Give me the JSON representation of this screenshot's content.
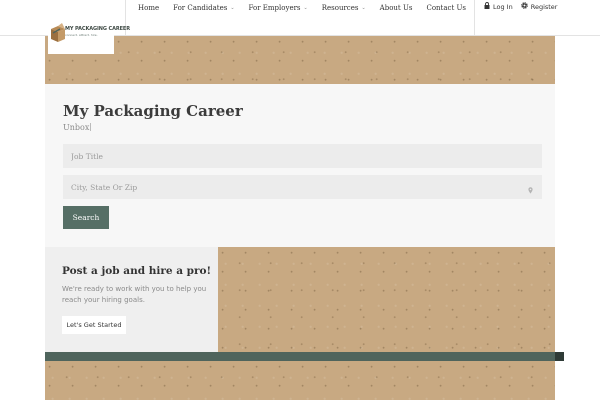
{
  "brand": {
    "name": "MY PACKAGING CAREER",
    "tagline": "connect. attract. hire.",
    "colors": {
      "accent": "#566f66",
      "stripe": "#4f645c",
      "cardboard": "#c8a982"
    }
  },
  "nav": {
    "items": [
      {
        "label": "Home",
        "dropdown": false
      },
      {
        "label": "For Candidates",
        "dropdown": true
      },
      {
        "label": "For Employers",
        "dropdown": true
      },
      {
        "label": "Resources",
        "dropdown": true
      },
      {
        "label": "About Us",
        "dropdown": false
      },
      {
        "label": "Contact Us",
        "dropdown": false
      }
    ],
    "chevron": "⌄"
  },
  "auth": {
    "login": {
      "label": "Log In",
      "icon": "lock-icon"
    },
    "register": {
      "label": "Register",
      "icon": "gear-icon"
    }
  },
  "search": {
    "title": "My Packaging Career",
    "subtitle": "Unbox",
    "job_placeholder": "Job Title",
    "location_placeholder": "City, State Or Zip",
    "button_label": "Search"
  },
  "hire": {
    "title": "Post a job and hire a pro!",
    "text": "We're ready to work with you to help you reach your hiring goals.",
    "button_label": "Let's Get Started"
  }
}
